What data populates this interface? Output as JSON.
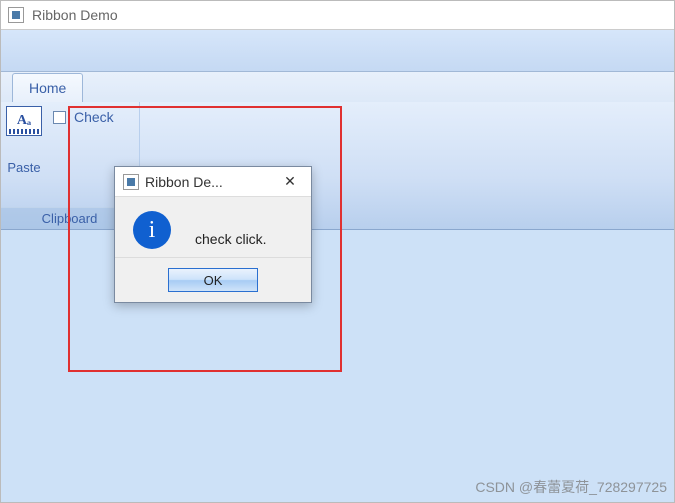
{
  "window": {
    "title": "Ribbon Demo"
  },
  "ribbon": {
    "tab": "Home",
    "group_title": "Clipboard",
    "paste_label": "Paste",
    "check_label": "Check"
  },
  "dialog": {
    "title": "Ribbon De...",
    "message": "check click.",
    "ok_label": "OK"
  },
  "watermark": "CSDN @春蕾夏荷_728297725"
}
